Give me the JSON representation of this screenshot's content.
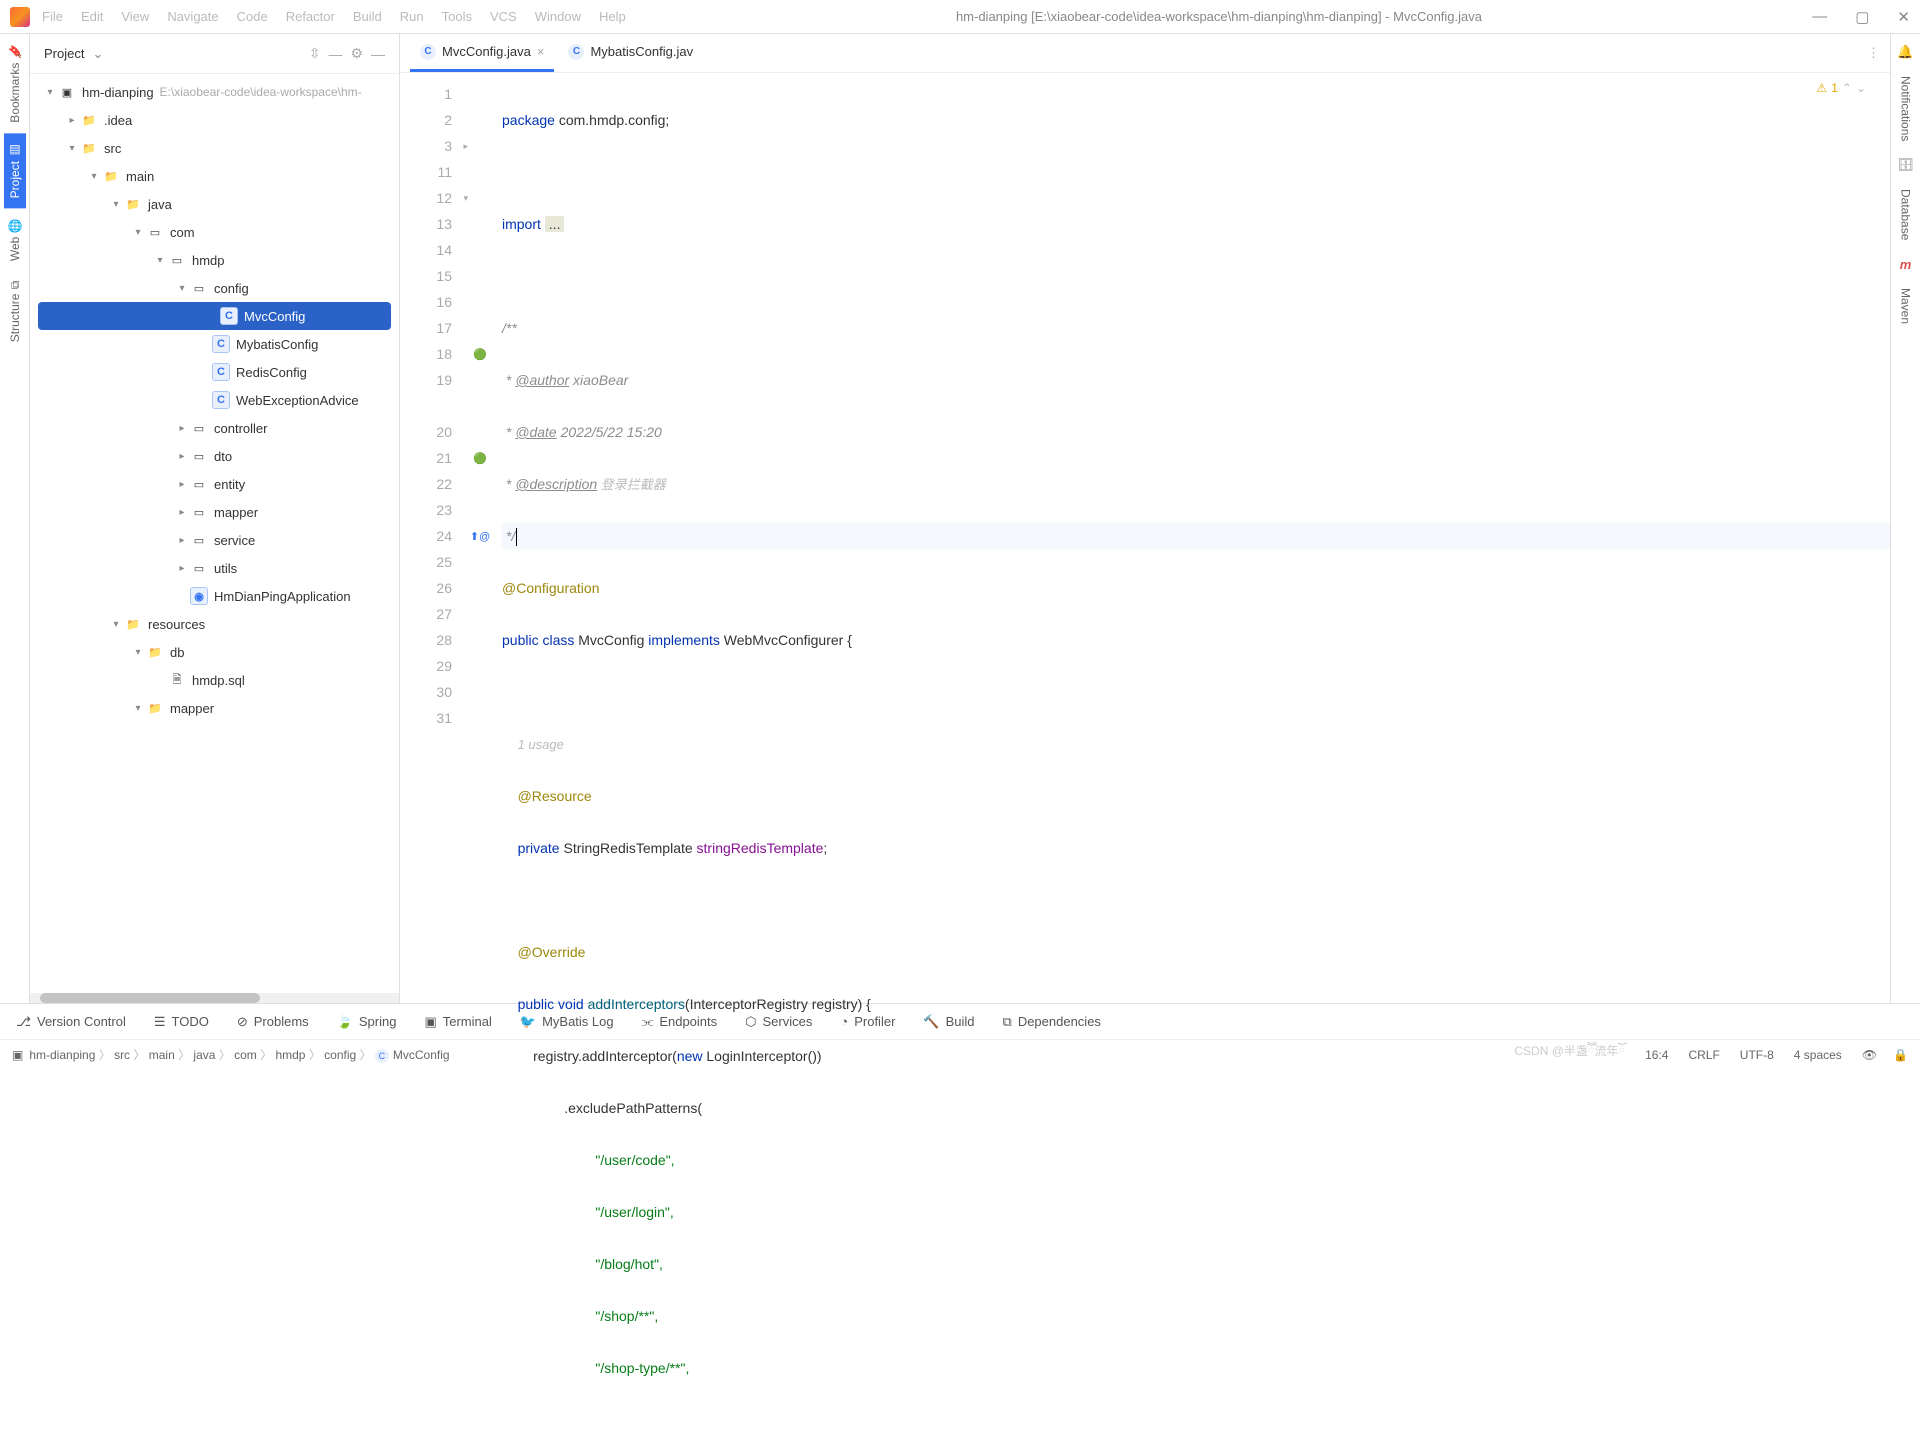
{
  "titlebar": {
    "menu": [
      "File",
      "Edit",
      "View",
      "Navigate",
      "Code",
      "Refactor",
      "Build",
      "Run",
      "Tools",
      "VCS",
      "Window",
      "Help"
    ],
    "title": "hm-dianping [E:\\xiaobear-code\\idea-workspace\\hm-dianping\\hm-dianping] - MvcConfig.java"
  },
  "left_rail": [
    {
      "label": "Bookmarks",
      "icon": "bookmark-icon"
    },
    {
      "label": "Project",
      "icon": "project-icon",
      "active": true
    },
    {
      "label": "Web",
      "icon": "web-icon"
    },
    {
      "label": "Structure",
      "icon": "structure-icon"
    }
  ],
  "project_panel": {
    "title": "Project",
    "root": {
      "name": "hm-dianping",
      "path": "E:\\xiaobear-code\\idea-workspace\\hm-"
    },
    "tree": [
      {
        "depth": 0,
        "arrow": "▾",
        "icon": "module",
        "label": "hm-dianping",
        "suffix": "E:\\xiaobear-code\\idea-workspace\\hm-"
      },
      {
        "depth": 1,
        "arrow": "▸",
        "icon": "folder",
        "label": ".idea"
      },
      {
        "depth": 1,
        "arrow": "▾",
        "icon": "folder",
        "label": "src"
      },
      {
        "depth": 2,
        "arrow": "▾",
        "icon": "folder",
        "label": "main"
      },
      {
        "depth": 3,
        "arrow": "▾",
        "icon": "source",
        "label": "java"
      },
      {
        "depth": 4,
        "arrow": "▾",
        "icon": "package",
        "label": "com"
      },
      {
        "depth": 5,
        "arrow": "▾",
        "icon": "package",
        "label": "hmdp"
      },
      {
        "depth": 6,
        "arrow": "▾",
        "icon": "package",
        "label": "config"
      },
      {
        "depth": 7,
        "arrow": "",
        "icon": "class",
        "label": "MvcConfig",
        "selected": true
      },
      {
        "depth": 7,
        "arrow": "",
        "icon": "class",
        "label": "MybatisConfig"
      },
      {
        "depth": 7,
        "arrow": "",
        "icon": "class",
        "label": "RedisConfig"
      },
      {
        "depth": 7,
        "arrow": "",
        "icon": "class",
        "label": "WebExceptionAdvice"
      },
      {
        "depth": 6,
        "arrow": "▸",
        "icon": "package",
        "label": "controller"
      },
      {
        "depth": 6,
        "arrow": "▸",
        "icon": "package",
        "label": "dto"
      },
      {
        "depth": 6,
        "arrow": "▸",
        "icon": "package",
        "label": "entity"
      },
      {
        "depth": 6,
        "arrow": "▸",
        "icon": "package",
        "label": "mapper"
      },
      {
        "depth": 6,
        "arrow": "▸",
        "icon": "package",
        "label": "service"
      },
      {
        "depth": 6,
        "arrow": "▸",
        "icon": "package",
        "label": "utils"
      },
      {
        "depth": 6,
        "arrow": "",
        "icon": "spring",
        "label": "HmDianPingApplication"
      },
      {
        "depth": 3,
        "arrow": "▾",
        "icon": "resources",
        "label": "resources"
      },
      {
        "depth": 4,
        "arrow": "▾",
        "icon": "folder",
        "label": "db"
      },
      {
        "depth": 5,
        "arrow": "",
        "icon": "sql",
        "label": "hmdp.sql"
      },
      {
        "depth": 4,
        "arrow": "▾",
        "icon": "folder",
        "label": "mapper"
      }
    ]
  },
  "editor": {
    "tabs": [
      {
        "label": "MvcConfig.java",
        "active": true,
        "closeable": true
      },
      {
        "label": "MybatisConfig.jav",
        "active": false,
        "closeable": false
      }
    ],
    "warnings": "1",
    "gutters": [
      "1",
      "2",
      "3",
      "11",
      "12",
      "13",
      "14",
      "15",
      "16",
      "17",
      "18",
      "19",
      "",
      "20",
      "21",
      "22",
      "23",
      "24",
      "25",
      "26",
      "27",
      "28",
      "29",
      "30",
      "31"
    ],
    "code": {
      "l1_kw": "package",
      "l1_rest": " com.hmdp.config;",
      "l3_kw": "import",
      "l3_fold": "...",
      "l12": "/**",
      "l13_pre": " * ",
      "l13_tag": "@author",
      "l13_txt": " xiaoBear",
      "l14_pre": " * ",
      "l14_tag": "@date",
      "l14_txt": " 2022/5/22 15:20",
      "l15_pre": " * ",
      "l15_tag": "@description",
      "l15_txt": " 登录拦截器",
      "l16": " */",
      "l17": "@Configuration",
      "l18_kw1": "public class ",
      "l18_cls": "MvcConfig ",
      "l18_kw2": "implements ",
      "l18_if": "WebMvcConfigurer {",
      "usage": "1 usage",
      "l20": "@Resource",
      "l21_kw": "private ",
      "l21_type": "StringRedisTemplate ",
      "l21_fld": "stringRedisTemplate",
      "l21_end": ";",
      "l23": "@Override",
      "l24_kw": "public void ",
      "l24_mth": "addInterceptors",
      "l24_sig": "(InterceptorRegistry registry) {",
      "l25_pre": "        registry.addInterceptor(",
      "l25_kw": "new ",
      "l25_rest": "LoginInterceptor())",
      "l26": "                .excludePathPatterns(",
      "l27": "                        \"/user/code\",",
      "l28": "                        \"/user/login\",",
      "l29": "                        \"/blog/hot\",",
      "l30": "                        \"/shop/**\",",
      "l31": "                        \"/shop-type/**\","
    }
  },
  "right_rail": [
    {
      "label": "Notifications",
      "icon": "bell-icon"
    },
    {
      "label": "Database",
      "icon": "database-icon"
    },
    {
      "label": "Maven",
      "icon": "maven-icon"
    }
  ],
  "bottom_bar": [
    {
      "icon": "branch",
      "label": "Version Control"
    },
    {
      "icon": "todo",
      "label": "TODO"
    },
    {
      "icon": "problems",
      "label": "Problems"
    },
    {
      "icon": "spring",
      "label": "Spring"
    },
    {
      "icon": "terminal",
      "label": "Terminal"
    },
    {
      "icon": "mybatis",
      "label": "MyBatis Log"
    },
    {
      "icon": "endpoints",
      "label": "Endpoints"
    },
    {
      "icon": "services",
      "label": "Services"
    },
    {
      "icon": "profiler",
      "label": "Profiler"
    },
    {
      "icon": "build",
      "label": "Build"
    },
    {
      "icon": "deps",
      "label": "Dependencies"
    }
  ],
  "breadcrumbs": [
    "hm-dianping",
    "src",
    "main",
    "java",
    "com",
    "hmdp",
    "config",
    "MvcConfig"
  ],
  "status": {
    "pos": "16:4",
    "sep": "CRLF",
    "enc": "UTF-8",
    "indent": "4 spaces",
    "watermark": "CSDN @半盏ཽ流年ོ"
  }
}
